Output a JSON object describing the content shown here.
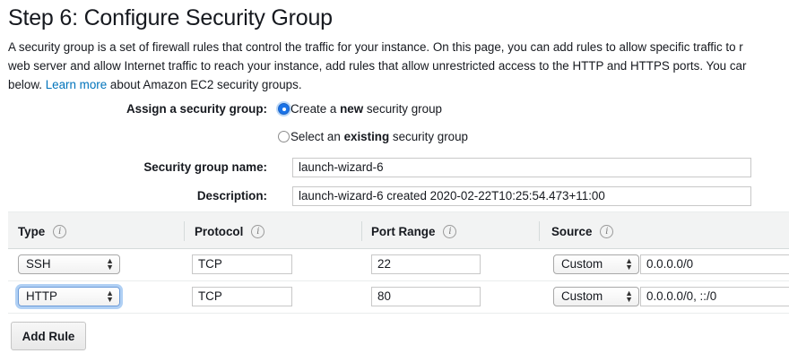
{
  "page": {
    "title": "Step 6: Configure Security Group",
    "intro_line1": "A security group is a set of firewall rules that control the traffic for your instance. On this page, you can add rules to allow specific traffic to r",
    "intro_line2": "web server and allow Internet traffic to reach your instance, add rules that allow unrestricted access to the HTTP and HTTPS ports. You car",
    "intro_line3_prefix": "below.",
    "learn_more": "Learn more",
    "intro_line3_suffix": "about Amazon EC2 security groups."
  },
  "form": {
    "assign_label": "Assign a security group:",
    "option_create_pre": "Create a ",
    "option_create_bold": "new",
    "option_create_post": " security group",
    "option_existing_pre": "Select an ",
    "option_existing_bold": "existing",
    "option_existing_post": " security group",
    "selected_option": "create",
    "name_label": "Security group name:",
    "name_value": "launch-wizard-6",
    "description_label": "Description:",
    "description_value": "launch-wizard-6 created 2020-02-22T10:25:54.473+11:00"
  },
  "table": {
    "columns": [
      {
        "label": "Type"
      },
      {
        "label": "Protocol"
      },
      {
        "label": "Port Range"
      },
      {
        "label": "Source"
      }
    ],
    "info_glyph": "i",
    "rows": [
      {
        "type": "SSH",
        "protocol": "TCP",
        "port_range": "22",
        "source_mode": "Custom",
        "source_value": "0.0.0.0/0"
      },
      {
        "type": "HTTP",
        "protocol": "TCP",
        "port_range": "80",
        "source_mode": "Custom",
        "source_value": "0.0.0.0/0, ::/0"
      }
    ]
  },
  "actions": {
    "add_rule": "Add Rule"
  },
  "colors": {
    "link": "#0073bb",
    "header_bg": "#f2f3f3",
    "radio_selected": "#1a73e8"
  }
}
